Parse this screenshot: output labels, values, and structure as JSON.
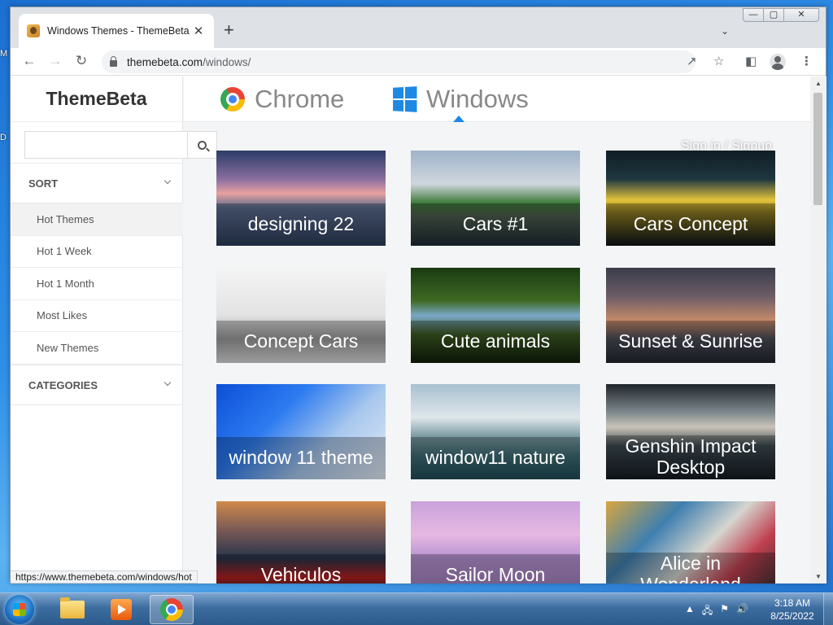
{
  "desktop": {
    "frag_top": "M",
    "frag_mid": "D"
  },
  "browser": {
    "tab_title": "Windows Themes - ThemeBeta",
    "tab_close": "✕",
    "new_tab": "+",
    "tab_search": "⌄",
    "win_min": "—",
    "win_max": "▢",
    "win_close": "✕",
    "url_host": "themebeta.com",
    "url_path": "/windows/",
    "status_url": "https://www.themebeta.com/windows/hot"
  },
  "site": {
    "logo": "ThemeBeta",
    "nav": [
      {
        "label": "Chrome"
      },
      {
        "label": "Windows"
      }
    ],
    "signin": "Sign in / Signup",
    "search_placeholder": "",
    "sort_header": "SORT",
    "sort_items": [
      {
        "label": "Hot Themes",
        "active": true
      },
      {
        "label": "Hot 1 Week"
      },
      {
        "label": "Hot 1 Month"
      },
      {
        "label": "Most Likes"
      },
      {
        "label": "New Themes"
      }
    ],
    "categories_header": "CATEGORIES",
    "themes": [
      {
        "title": "designing 22",
        "bg": "linear-gradient(180deg,#2b3b67 0%,#8a6fa0 30%,#e7a0a0 45%,#5b6c8e 60%,#2c3b57 100%)"
      },
      {
        "title": "Cars #1",
        "bg": "linear-gradient(180deg,#9fb3c9 0%,#cfd7de 35%,#3f7a3a 55%,#4b5a4d 70%,#1b2a30 100%)"
      },
      {
        "title": "Cars Concept",
        "bg": "linear-gradient(180deg,#101d24 0%,#1e3640 30%,#e2c43a 52%,#8c7a21 65%,#0b1216 100%)"
      },
      {
        "title": "Concept Cars",
        "bg": "linear-gradient(180deg,#f4f4f4 0%,#e3e3e3 50%,#9a9a9a 75%,#d9d9d9 100%)"
      },
      {
        "title": "Cute animals",
        "bg": "linear-gradient(180deg,#1a3a12 0%,#3f6a25 35%,#7aa8c8 50%,#3c5a22 70%,#0f1d0a 100%)"
      },
      {
        "title": "Sunset & Sunrise",
        "bg": "linear-gradient(180deg,#3a3c4a 0%,#6b5c66 30%,#c48a6a 55%,#4a4c58 75%,#22242e 100%)"
      },
      {
        "title": "window 11 theme",
        "bg": "linear-gradient(135deg,#0b4fd8 0%,#2d7bf0 35%,#a9c8ee 65%,#e4ecf6 100%)"
      },
      {
        "title": "window11 nature",
        "bg": "linear-gradient(180deg,#a7c0d0 0%,#dfe7ea 35%,#7b9aa2 55%,#3f6d76 75%,#1f4a55 100%)"
      },
      {
        "title": "Genshin Impact Desktop",
        "bg": "linear-gradient(180deg,#20262c 0%,#7f8a8e 30%,#c9c3b8 45%,#3d4a52 65%,#141a20 100%)"
      },
      {
        "title": "Vehiculos",
        "bg": "linear-gradient(180deg,#d08a4a 0%,#7a5a56 30%,#27344a 60%,#b32020 80%,#151a22 100%)"
      },
      {
        "title": "Sailor Moon",
        "bg": "linear-gradient(180deg,#c9a3dc 0%,#e6b8e2 35%,#b693d0 60%,#9c7bb8 100%)"
      },
      {
        "title": "Alice in Wonderland",
        "bg": "linear-gradient(135deg,#d8a640 0%,#3f7fb0 30%,#d5d5cf 55%,#c04050 75%,#2e2e2e 100%)"
      }
    ]
  },
  "taskbar": {
    "time": "3:18 AM",
    "date": "8/25/2022",
    "tray_arrow": "▲",
    "tray_network": "🖧",
    "tray_flag": "⚑",
    "tray_volume": "🔊"
  }
}
